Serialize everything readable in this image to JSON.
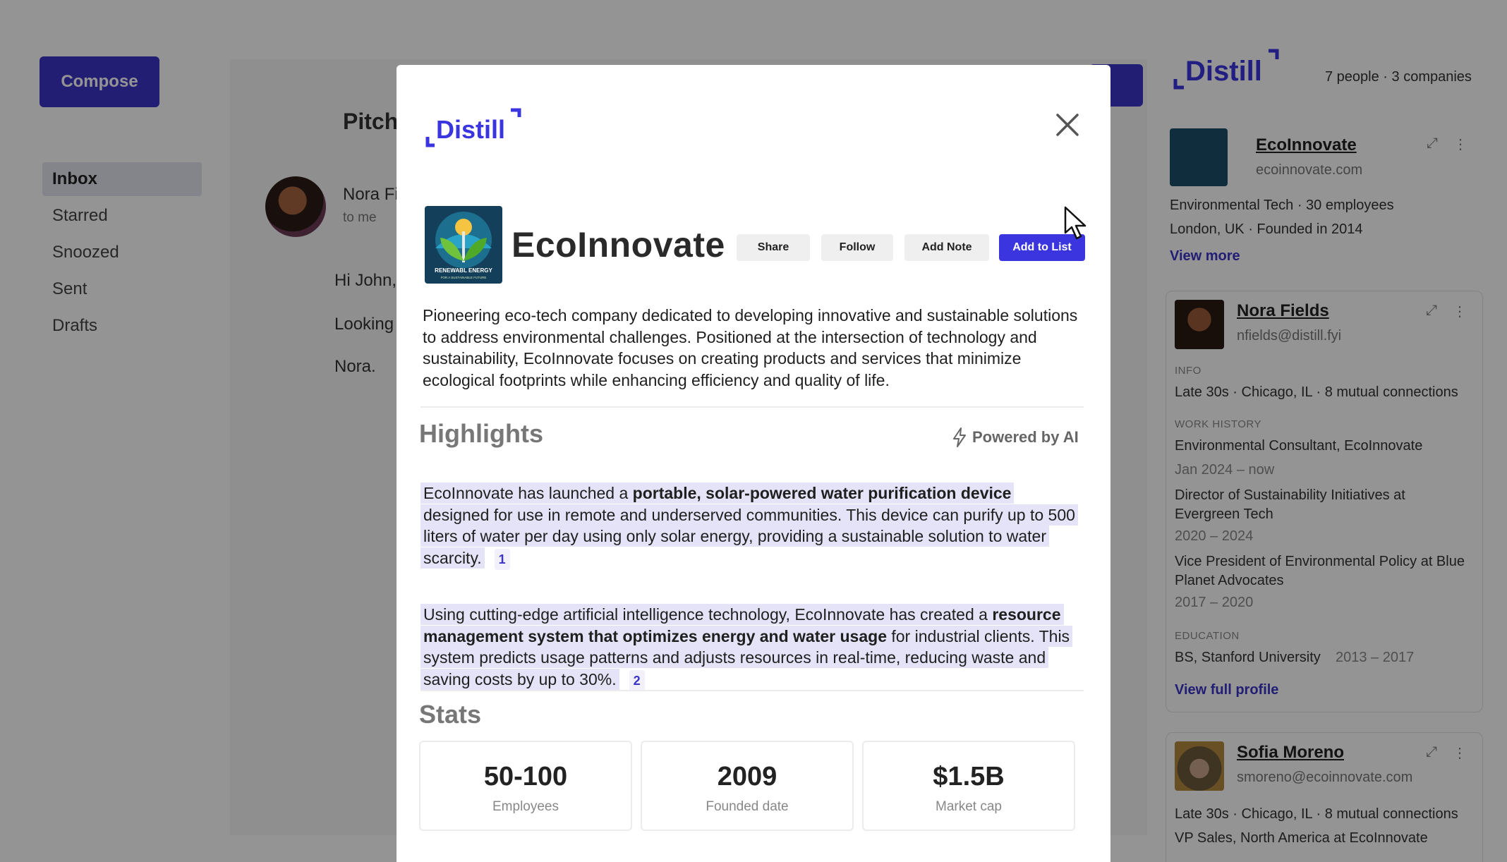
{
  "bg": {
    "compose_label": "Compose",
    "nav": [
      "Inbox",
      "Starred",
      "Snoozed",
      "Sent",
      "Drafts"
    ],
    "mail": {
      "subject": "Pitch",
      "from": "Nora Fi",
      "to": "to me",
      "lines": [
        "Hi John,",
        "Looking",
        "Nora."
      ]
    },
    "right_panel": {
      "logo": "Distill",
      "count": "7 people · 3 companies",
      "company_card": {
        "name": "EcoInnovate",
        "domain": "ecoinnovate.com",
        "line1": "Environmental Tech · 30 employees",
        "line2": "London, UK · Founded in 2014",
        "link": "View more"
      },
      "person_card": {
        "name": "Nora Fields",
        "email": "nfields@distill.fyi",
        "info_label": "INFO",
        "info": "Late 30s · Chicago, IL · 8 mutual connections",
        "work_label": "WORK HISTORY",
        "jobs": [
          {
            "title": "Environmental Consultant, EcoInnovate",
            "dates": "Jan 2024 – now"
          },
          {
            "title": "Director of Sustainability Initiatives at Evergreen Tech",
            "dates": "2020 – 2024"
          },
          {
            "title": "Vice President of Environmental Policy at Blue Planet Advocates",
            "dates": "2017 – 2020"
          }
        ],
        "edu_label": "EDUCATION",
        "edu": "BS, Stanford University",
        "edu_dates": "2013 – 2017",
        "link": "View full profile"
      },
      "person_card2": {
        "name": "Sofia Moreno",
        "email": "smoreno@ecoinnovate.com",
        "info": "Late 30s · Chicago, IL · 8 mutual connections",
        "cut_line": "VP Sales, North America at EcoInnovate"
      }
    }
  },
  "modal": {
    "logo": "Distill",
    "company": {
      "name": "EcoInnovate",
      "logo_text": "RENEWABL ENERGY",
      "logo_subtext": "FOR A SUSTAINABLE FUTURE",
      "description": "Pioneering eco-tech company dedicated to developing innovative and sustainable solutions to address environmental challenges. Positioned at the intersection of technology and sustainability, EcoInnovate focuses on creating products and services that minimize ecological footprints while enhancing efficiency and quality of life."
    },
    "buttons": {
      "share": "Share",
      "follow": "Follow",
      "add_note": "Add Note",
      "add_to_list": "Add to List"
    },
    "highlights": {
      "title": "Highlights",
      "powered": "Powered by AI",
      "items": [
        {
          "pre": "EcoInnovate has launched a ",
          "bold": "portable, solar-powered water purification device",
          "post": " designed for use in remote and underserved communities. This device can purify up to 500 liters of water per day using only solar energy, providing a sustainable solution to water scarcity.",
          "cite": "1"
        },
        {
          "pre": "Using cutting-edge artificial intelligence technology, EcoInnovate has created a ",
          "bold": "resource management system that optimizes energy and water usage",
          "post": " for industrial clients. This system predicts usage patterns and adjusts resources in real-time, reducing waste and saving costs by up to 30%.",
          "cite": "2"
        }
      ]
    },
    "stats": {
      "title": "Stats",
      "items": [
        {
          "value": "50-100",
          "label": "Employees"
        },
        {
          "value": "2009",
          "label": "Founded date"
        },
        {
          "value": "$1.5B",
          "label": "Market cap"
        }
      ]
    }
  },
  "colors": {
    "accent": "#3b35e0",
    "highlight": "#e4e3f7",
    "overlay": "rgba(0,0,0,0.42)"
  }
}
